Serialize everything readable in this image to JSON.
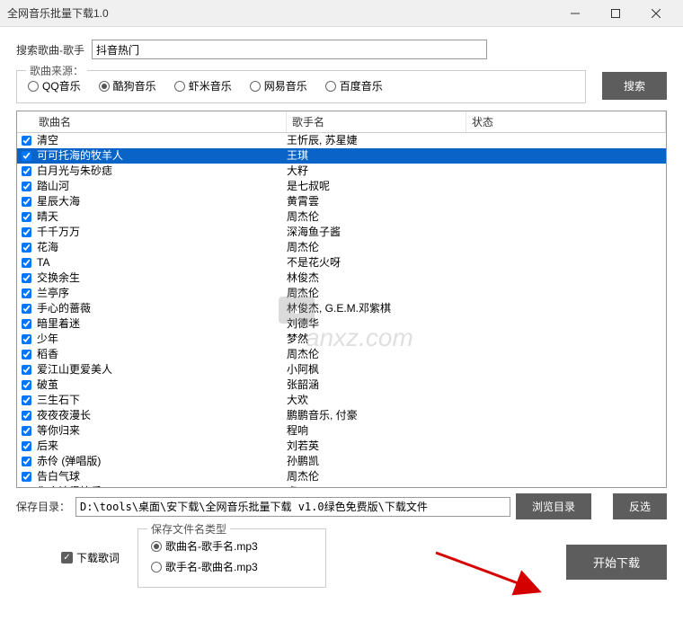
{
  "window": {
    "title": "全网音乐批量下载1.0"
  },
  "search": {
    "label": "搜索歌曲-歌手",
    "value": "抖音热门"
  },
  "source": {
    "legend": "歌曲来源：",
    "options": [
      "QQ音乐",
      "酷狗音乐",
      "虾米音乐",
      "网易音乐",
      "百度音乐"
    ],
    "selected": 1
  },
  "buttons": {
    "search": "搜索",
    "browse": "浏览目录",
    "invert": "反选",
    "start": "开始下载"
  },
  "columns": {
    "song": "歌曲名",
    "singer": "歌手名",
    "status": "状态"
  },
  "rows": [
    {
      "song": "清空",
      "singer": "王忻辰, 苏星婕",
      "checked": true,
      "sel": false
    },
    {
      "song": "可可托海的牧羊人",
      "singer": "王琪",
      "checked": true,
      "sel": true
    },
    {
      "song": "白月光与朱砂痣",
      "singer": "大籽",
      "checked": true,
      "sel": false
    },
    {
      "song": "踏山河",
      "singer": "是七叔呢",
      "checked": true,
      "sel": false
    },
    {
      "song": "星辰大海",
      "singer": "黄霄雲",
      "checked": true,
      "sel": false
    },
    {
      "song": "晴天",
      "singer": "周杰伦",
      "checked": true,
      "sel": false
    },
    {
      "song": "千千万万",
      "singer": "深海鱼子酱",
      "checked": true,
      "sel": false
    },
    {
      "song": "花海",
      "singer": "周杰伦",
      "checked": true,
      "sel": false
    },
    {
      "song": "TA",
      "singer": "不是花火呀",
      "checked": true,
      "sel": false
    },
    {
      "song": "交换余生",
      "singer": "林俊杰",
      "checked": true,
      "sel": false
    },
    {
      "song": "兰亭序",
      "singer": "周杰伦",
      "checked": true,
      "sel": false
    },
    {
      "song": "手心的蔷薇",
      "singer": "林俊杰, G.E.M.邓紫棋",
      "checked": true,
      "sel": false
    },
    {
      "song": "暗里着迷",
      "singer": "刘德华",
      "checked": true,
      "sel": false
    },
    {
      "song": "少年",
      "singer": "梦然",
      "checked": true,
      "sel": false
    },
    {
      "song": "稻香",
      "singer": "周杰伦",
      "checked": true,
      "sel": false
    },
    {
      "song": "爱江山更爱美人",
      "singer": "小阿枫",
      "checked": true,
      "sel": false
    },
    {
      "song": "破茧",
      "singer": "张韶涵",
      "checked": true,
      "sel": false
    },
    {
      "song": "三生石下",
      "singer": "大欢",
      "checked": true,
      "sel": false
    },
    {
      "song": "夜夜夜漫长",
      "singer": "鹏鹏音乐, 付豪",
      "checked": true,
      "sel": false
    },
    {
      "song": "等你归来",
      "singer": "程响",
      "checked": true,
      "sel": false
    },
    {
      "song": "后来",
      "singer": "刘若英",
      "checked": true,
      "sel": false
    },
    {
      "song": "赤伶 (弹唱版)",
      "singer": "孙鹏凯",
      "checked": true,
      "sel": false
    },
    {
      "song": "告白气球",
      "singer": "周杰伦",
      "checked": true,
      "sel": false
    },
    {
      "song": "你应该很快乐",
      "singer": "虎二",
      "checked": true,
      "sel": false
    }
  ],
  "path": {
    "label": "保存目录：",
    "value": "D:\\tools\\桌面\\安下载\\全网音乐批量下载 v1.0绿色免费版\\下载文件"
  },
  "lrc": {
    "label": "下载歌词",
    "checked": true
  },
  "fname": {
    "legend": "保存文件名类型",
    "options": [
      "歌曲名-歌手名.mp3",
      "歌手名-歌曲名.mp3"
    ],
    "selected": 0
  },
  "watermark": "anxz.com"
}
